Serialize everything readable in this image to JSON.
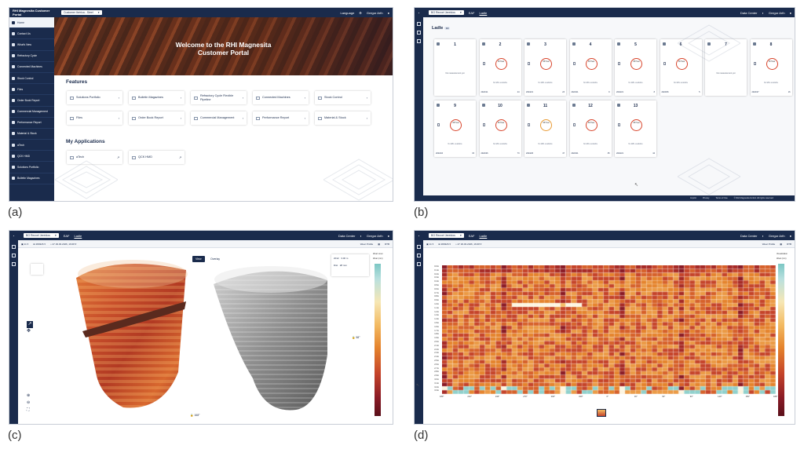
{
  "captions": [
    "(a)",
    "(b)",
    "(c)",
    "(d)"
  ],
  "a": {
    "app_title": "RHI Magnesita Customer Portal",
    "customer_select": "Customer Ibérica - Steel",
    "language_label": "Language",
    "user_name": "Gregor Arth",
    "sidebar": [
      "Home",
      "Contact Us",
      "What's New",
      "Refractory Cycle",
      "Connected Machines",
      "Stock Control",
      "Files",
      "Order Book Report",
      "Commercial Management",
      "Performance Report",
      "Material & Stock",
      "aTech",
      "QCK HMD",
      "Solutions Portfolio",
      "Bulletin Magazines"
    ],
    "hero_title": "Welcome to the RHI Magnesita Customer Portal",
    "features_title": "Features",
    "features": [
      "Solutions Portfolio",
      "Bulletin Magazines",
      "Refractory Cycle Flexible Pipeline",
      "Connected Machines",
      "Stock Control",
      "Files",
      "Order Book Report",
      "Commercial Management",
      "Performance Report",
      "Material & Stock"
    ],
    "apps_title": "My Applications",
    "apps": [
      "aTech",
      "QCK HMD"
    ]
  },
  "b": {
    "plant_select": "BG Recvel Jereidos",
    "nav": [
      "EAF",
      "Ladle"
    ],
    "right_nav": "Data Center",
    "user_name": "Gregor Arth",
    "section_title": "Ladle",
    "section_count": "13",
    "tiles": [
      {
        "name": "1",
        "empty": true,
        "msg": "No measurement yet"
      },
      {
        "name": "2",
        "ring": "88 Heat",
        "date": "2024/11",
        "count": "24"
      },
      {
        "name": "3",
        "ring": "88 Heat",
        "date": "2024/21",
        "count": "23"
      },
      {
        "name": "4",
        "ring": "88 Heat",
        "date": "2024/21",
        "count": "9"
      },
      {
        "name": "5",
        "ring": "88 Heat",
        "date": "2024/21",
        "count": "8"
      },
      {
        "name": "6",
        "ring": "88 Heat",
        "date": "2024/06",
        "count": "5"
      },
      {
        "name": "7",
        "empty": true,
        "msg": "No measurement yet"
      },
      {
        "name": "8",
        "ring": "88 Heat",
        "date": "2024/27",
        "count": "16"
      },
      {
        "name": "9",
        "ring": "88 Heat",
        "date": "2024/16",
        "count": "15"
      },
      {
        "name": "10",
        "ring": "88 Heat",
        "date": "2024/26",
        "count": "73"
      },
      {
        "name": "11",
        "ring": "88 Heat",
        "date": "2024/26",
        "count": "47",
        "orange": true
      },
      {
        "name": "12",
        "ring": "88 Heat",
        "date": "2024/21",
        "count": "35"
      },
      {
        "name": "13",
        "ring": "88 Heat",
        "date": "2024/21",
        "count": "44"
      }
    ],
    "tile_label": "No EBL available",
    "footer": [
      "Imprint",
      "Privacy",
      "Terms of Use",
      "© RHI Magnesita GmbH. All rights reserved"
    ]
  },
  "c": {
    "plant_select": "BG Recvel Jereidos",
    "nav": [
      "EAF",
      "Ladle"
    ],
    "right_nav": "Data Center",
    "user_name": "Gregor Arth",
    "ladle_no": "11",
    "campaign": "280326",
    "heat": "47",
    "date": "29.03.2026, 16:08",
    "view_tabs": [
      "View",
      "Overlay"
    ],
    "toggle": "Wear Profile",
    "rtb": "RTB",
    "readout": [
      "2012",
      "Dist",
      "3.00 m",
      "28 mm"
    ],
    "angle_right": "58°",
    "angle_bottom": "168°",
    "scale_title": "Wear Lines",
    "scale_unit": "Wear (mm)"
  },
  "d": {
    "plant_select": "BG Recvel Jereidos",
    "nav": [
      "EAF",
      "Ladle"
    ],
    "right_nav": "Data Center",
    "user_name": "Gregor Arth",
    "ladle_no": "11",
    "campaign": "280326",
    "heat": "47",
    "date": "29.03.2026, 16:08",
    "toggle": "Wear Profile",
    "rtb": "RTB",
    "scale_title": "Visualization",
    "scale_unit": "Wear (mm)",
    "y_ticks": [
      "0.0m",
      "0.1m",
      "0.2m",
      "0.3m",
      "0.4m",
      "0.5m",
      "0.6m",
      "0.7m",
      "0.8m",
      "0.9m",
      "1.0m",
      "1.1m",
      "1.2m",
      "1.3m",
      "1.4m",
      "1.5m",
      "1.6m",
      "1.7m",
      "1.8m",
      "1.9m",
      "2.0m",
      "2.1m",
      "2.2m",
      "2.3m",
      "2.4m",
      "2.5m",
      "2.6m",
      "2.7m",
      "2.8m",
      "2.9m",
      "3.0m",
      "3.1m",
      "3.2m",
      "3.3m"
    ],
    "x_ticks": [
      "180°",
      "210°",
      "240°",
      "270°",
      "300°",
      "330°",
      "0°",
      "30°",
      "60°",
      "90°",
      "120°",
      "150°",
      "180°"
    ]
  }
}
